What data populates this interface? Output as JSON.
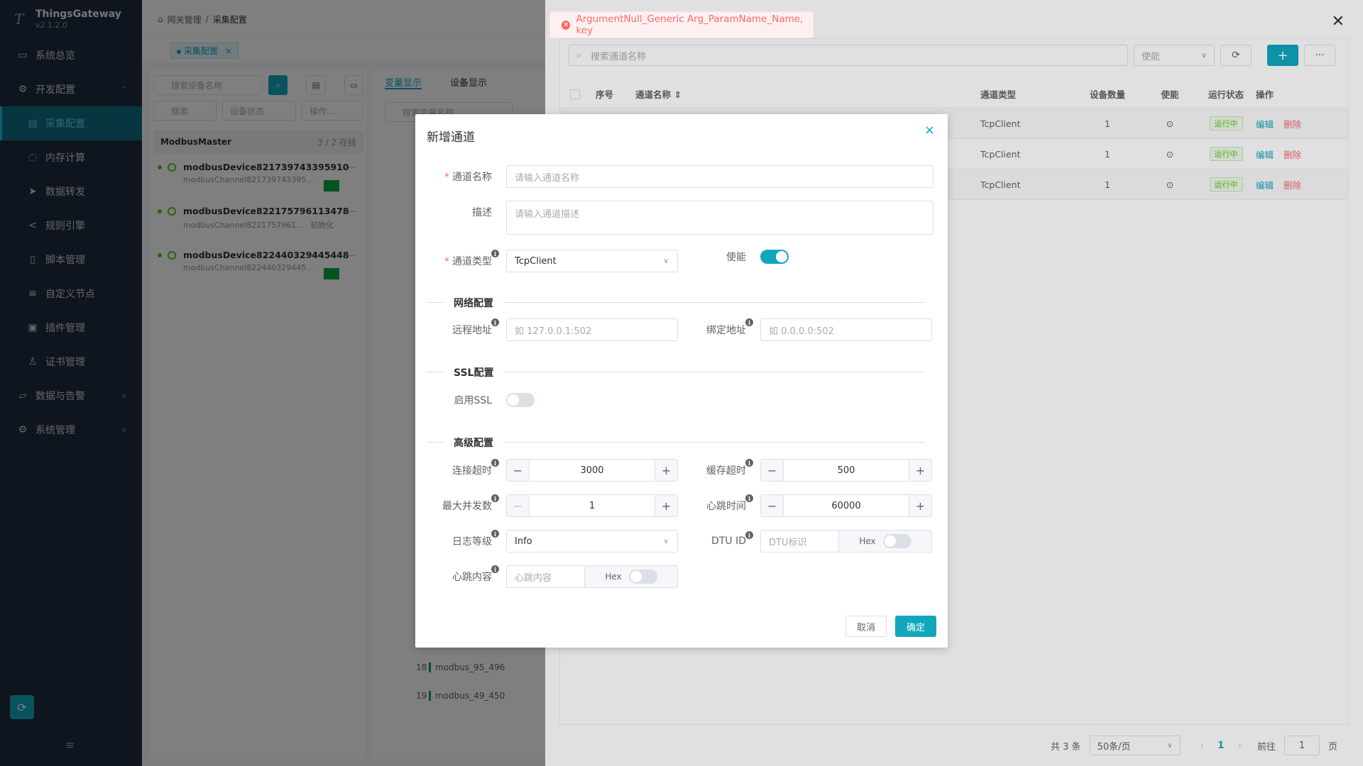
{
  "brand": {
    "name": "ThingsGateway",
    "version": "v2.1.2.0",
    "logo": "T"
  },
  "menu": [
    {
      "label": "系统总览",
      "icon": "monitor-icon",
      "glyph": "▭",
      "level": 0
    },
    {
      "label": "开发配置",
      "icon": "gear-icon",
      "glyph": "⚙",
      "level": 0,
      "caret": "^"
    },
    {
      "label": "采集配置",
      "icon": "collect-icon",
      "glyph": "▤",
      "level": 1,
      "active": true
    },
    {
      "label": "内存计算",
      "icon": "compute-icon",
      "glyph": "◌",
      "level": 1
    },
    {
      "label": "数据转发",
      "icon": "send-icon",
      "glyph": "➤",
      "level": 1
    },
    {
      "label": "规则引擎",
      "icon": "share-icon",
      "glyph": "<",
      "level": 1
    },
    {
      "label": "脚本管理",
      "icon": "script-icon",
      "glyph": "▯",
      "level": 1
    },
    {
      "label": "自定义节点",
      "icon": "sliders-icon",
      "glyph": "≡",
      "level": 1
    },
    {
      "label": "插件管理",
      "icon": "plugin-icon",
      "glyph": "▣",
      "level": 1
    },
    {
      "label": "证书管理",
      "icon": "cert-icon",
      "glyph": "♙",
      "level": 1
    },
    {
      "label": "数据与告警",
      "icon": "chart-icon",
      "glyph": "▱",
      "level": 0,
      "caret": "v"
    },
    {
      "label": "系统管理",
      "icon": "settings-icon",
      "glyph": "⚙",
      "level": 0,
      "caret": "v"
    }
  ],
  "breadcrumb": {
    "home": "网关管理",
    "sep": "/",
    "current": "采集配置"
  },
  "tab": {
    "label": "采集配置",
    "close": "×"
  },
  "device_panel": {
    "search_placeholder": "搜索设备名称",
    "filter_placeholder": "搜索",
    "status_placeholder": "设备状态",
    "op_placeholder": "操作...",
    "group": "ModbusMaster",
    "group_count": "3 / 2 在线",
    "devices": [
      {
        "name": "modbusDevice821739743395910",
        "sub": "modbusChannel821739743395...",
        "extra": ""
      },
      {
        "name": "modbusDevice822175796113478",
        "sub": "modbusChannel8221757961...",
        "extra": "初始化"
      },
      {
        "name": "modbusDevice822440329445448",
        "sub": "modbusChannel822440329445...",
        "extra": ""
      }
    ]
  },
  "var_panel": {
    "tab1": "变量显示",
    "tab2": "设备显示",
    "search_placeholder": "搜索变量名称",
    "rows": [
      {
        "idx": "18",
        "name": "modbus_95_496"
      },
      {
        "idx": "19",
        "name": "modbus_49_450"
      }
    ]
  },
  "drawer": {
    "search_placeholder": "搜索通道名称",
    "enable_select": "使能",
    "more": "···",
    "add": "+",
    "columns": {
      "idx": "序号",
      "name": "通道名称",
      "sort": "⇕",
      "type": "通道类型",
      "count": "设备数量",
      "enable": "使能",
      "status": "运行状态",
      "op": "操作"
    },
    "rows": [
      {
        "type": "TcpClient",
        "count": "1",
        "status": "运行中",
        "edit": "编辑",
        "del": "删除"
      },
      {
        "type": "TcpClient",
        "count": "1",
        "status": "运行中",
        "edit": "编辑",
        "del": "删除"
      },
      {
        "type": "TcpClient",
        "count": "1",
        "status": "运行中",
        "edit": "编辑",
        "del": "删除"
      }
    ],
    "pager": {
      "total": "共 3 条",
      "size": "50条/页",
      "page": "1",
      "goto": "前往",
      "goto_val": "1",
      "unit": "页"
    }
  },
  "toast": {
    "message": "ArgumentNull_Generic Arg_ParamName_Name, key",
    "icon": "×"
  },
  "dialog": {
    "title": "新增通道",
    "close": "×",
    "name_label": "通道名称",
    "name_placeholder": "请输入通道名称",
    "desc_label": "描述",
    "desc_placeholder": "请输入通道描述",
    "type_label": "通道类型",
    "type_value": "TcpClient",
    "enable_label": "使能",
    "net_section": "网络配置",
    "remote_label": "远程地址",
    "remote_placeholder": "如 127.0.0.1:502",
    "bind_label": "绑定地址",
    "bind_placeholder": "如 0.0.0.0:502",
    "ssl_section": "SSL配置",
    "ssl_label": "启用SSL",
    "adv_section": "高级配置",
    "conn_timeout_label": "连接超时",
    "conn_timeout": "3000",
    "cache_timeout_label": "缓存超时",
    "cache_timeout": "500",
    "max_conc_label": "最大并发数",
    "max_conc": "1",
    "heartbeat_time_label": "心跳时间",
    "heartbeat_time": "60000",
    "log_level_label": "日志等级",
    "log_level": "Info",
    "dtu_label": "DTU ID",
    "dtu_placeholder": "DTU标识",
    "hex": "Hex",
    "heartbeat_content_label": "心跳内容",
    "heartbeat_content_placeholder": "心跳内容",
    "cancel": "取消",
    "confirm": "确定",
    "minus": "−",
    "plus": "+",
    "req": "*",
    "info": "i"
  },
  "colors": {
    "primary": "#12a6bd",
    "danger": "#f56c6c",
    "success": "#52c41a",
    "sidebar": "#1f2a3c"
  }
}
